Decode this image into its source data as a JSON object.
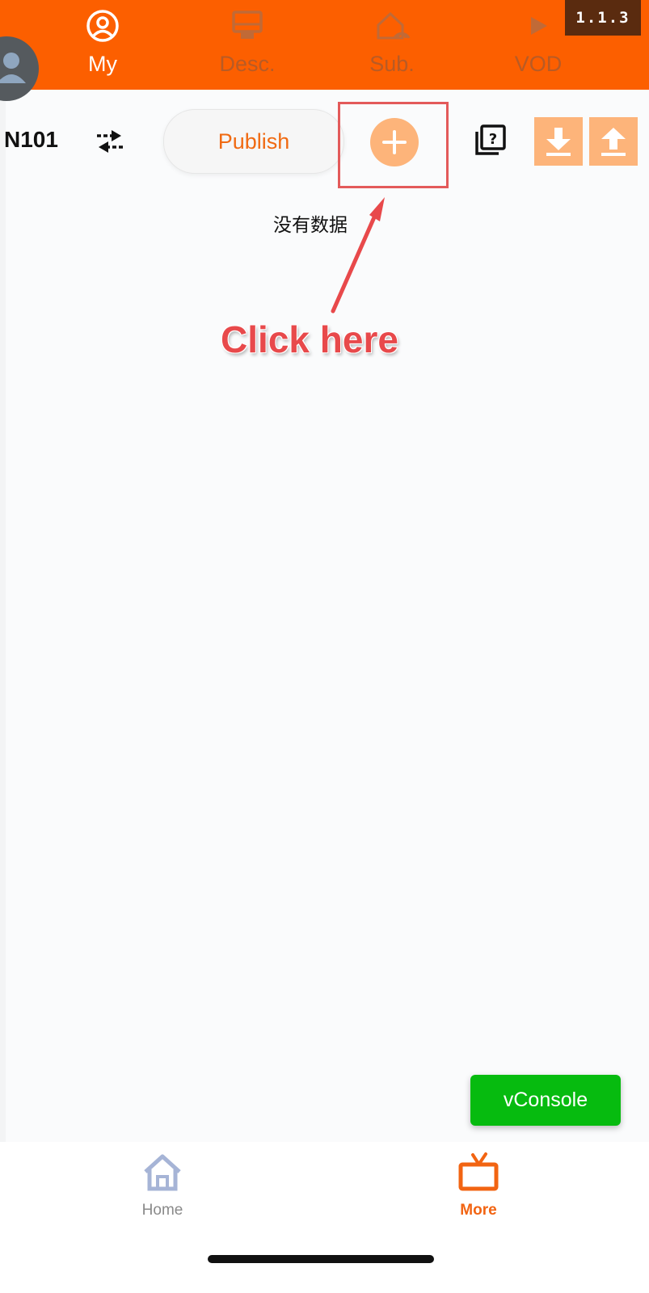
{
  "top_nav": {
    "tabs": [
      {
        "label": "My",
        "icon": "user-circle-icon",
        "active": true
      },
      {
        "label": "Desc.",
        "icon": "monitor-icon",
        "active": false
      },
      {
        "label": "Sub.",
        "icon": "home-signal-icon",
        "active": false
      },
      {
        "label": "VOD",
        "icon": "play-icon",
        "active": false
      }
    ],
    "version": "1.1.3",
    "accent_color": "#fc5f00"
  },
  "toolbar": {
    "device_name": "N101",
    "publish_label": "Publish",
    "icons": [
      "swap-arrows-icon",
      "plus-icon",
      "help-stack-icon",
      "download-icon",
      "upload-icon"
    ]
  },
  "content": {
    "empty_text": "没有数据"
  },
  "annotation": {
    "label": "Click here"
  },
  "vconsole": {
    "label": "vConsole"
  },
  "bottom_nav": {
    "tabs": [
      {
        "label": "Home",
        "icon": "house-icon",
        "active": false
      },
      {
        "label": "More",
        "icon": "tv-icon",
        "active": true
      }
    ]
  }
}
